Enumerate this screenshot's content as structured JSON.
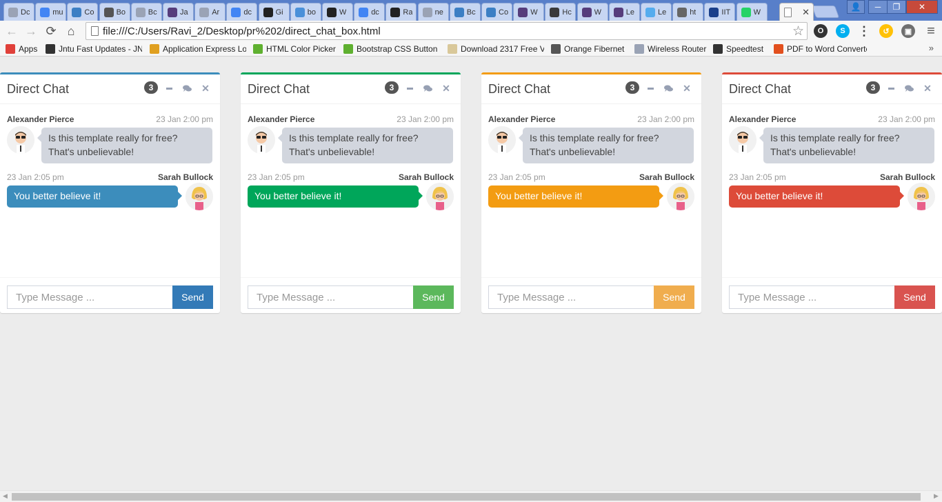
{
  "browser": {
    "tabs": [
      {
        "title": "Dc",
        "icon": "document-icon",
        "color": "#9aa3b5"
      },
      {
        "title": "mu",
        "icon": "google-icon",
        "color": "#4285f4"
      },
      {
        "title": "Co",
        "icon": "bootstrap-icon",
        "color": "#3c7fc4"
      },
      {
        "title": "Bo",
        "icon": "bootstrap-b-icon",
        "color": "#555555"
      },
      {
        "title": "Bc",
        "icon": "document-icon",
        "color": "#9aa3b5"
      },
      {
        "title": "Ja",
        "icon": "bootstrap-b-icon",
        "color": "#563d7c"
      },
      {
        "title": "Ar",
        "icon": "document-icon",
        "color": "#9aa3b5"
      },
      {
        "title": "dc",
        "icon": "google-icon",
        "color": "#4285f4"
      },
      {
        "title": "Gi",
        "icon": "github-icon",
        "color": "#222222"
      },
      {
        "title": "bo",
        "icon": "chrome-page-icon",
        "color": "#4a90d9"
      },
      {
        "title": "W",
        "icon": "github-icon",
        "color": "#222222"
      },
      {
        "title": "dc",
        "icon": "google-icon",
        "color": "#4285f4"
      },
      {
        "title": "Ra",
        "icon": "github-icon",
        "color": "#222222"
      },
      {
        "title": "ne",
        "icon": "document-icon",
        "color": "#9aa3b5"
      },
      {
        "title": "Bc",
        "icon": "bootstrap-icon",
        "color": "#3c7fc4"
      },
      {
        "title": "Co",
        "icon": "bootstrap-icon",
        "color": "#3c7fc4"
      },
      {
        "title": "W",
        "icon": "bootstrap-b-icon",
        "color": "#563d7c"
      },
      {
        "title": "Hc",
        "icon": "x-icon",
        "color": "#3a3a3a"
      },
      {
        "title": "W",
        "icon": "bootstrap-b-icon",
        "color": "#563d7c"
      },
      {
        "title": "Le",
        "icon": "bootstrap-b-icon",
        "color": "#563d7c"
      },
      {
        "title": "Le",
        "icon": "twitter-icon",
        "color": "#55acee"
      },
      {
        "title": "ht",
        "icon": "wifi-icon",
        "color": "#666666"
      },
      {
        "title": "IIT",
        "icon": "iitb-icon",
        "color": "#1a3f8a"
      },
      {
        "title": "W",
        "icon": "whatsapp-icon",
        "color": "#25d366"
      }
    ],
    "active_tab": {
      "close": "✕"
    },
    "window_controls": {
      "user": "👤",
      "minimize": "─",
      "maximize": "❐",
      "close": "✕"
    },
    "nav": {
      "back": "←",
      "forward": "→",
      "reload": "⟳",
      "home": "⌂"
    },
    "url": "file:///C:/Users/Ravi_2/Desktop/pr%202/direct_chat_box.html",
    "star": "☆",
    "extensions": [
      {
        "name": "opera-icon",
        "label": "O",
        "color": "#333333"
      },
      {
        "name": "skype-icon",
        "label": "S",
        "color": "#00aff0"
      },
      {
        "name": "apps-grid-icon",
        "label": "⋮",
        "color": "#444444"
      },
      {
        "name": "google-extension-icon",
        "label": "↺",
        "color": "#ffc107"
      },
      {
        "name": "ghostery-icon",
        "label": "▣",
        "color": "#6f6f6f"
      },
      {
        "name": "menu-icon",
        "label": "≡",
        "color": "#555555"
      }
    ],
    "bookmarks": [
      {
        "label": "Apps",
        "icon": "apps-icon",
        "color": "#e0403a"
      },
      {
        "label": "Jntu Fast Updates - JN",
        "icon": "graduation-cap-icon",
        "color": "#333333"
      },
      {
        "label": "Application Express Lo",
        "icon": "chart-icon",
        "color": "#e0a020"
      },
      {
        "label": "HTML Color Picker",
        "icon": "w3-icon",
        "color": "#5fb030"
      },
      {
        "label": "Bootstrap CSS Button",
        "icon": "w3-icon",
        "color": "#5fb030"
      },
      {
        "label": "Download 2317 Free V",
        "icon": "folder-icon",
        "color": "#d9c89a"
      },
      {
        "label": "Orange Fibernet",
        "icon": "wifi-icon",
        "color": "#555555"
      },
      {
        "label": "Wireless Router",
        "icon": "document-icon",
        "color": "#9aa3b5"
      },
      {
        "label": "Speedtest",
        "icon": "gauge-icon",
        "color": "#333333"
      },
      {
        "label": "PDF to Word Converte",
        "icon": "pdf-icon",
        "color": "#e2501e"
      }
    ],
    "bookmarks_more": "»"
  },
  "chat_common": {
    "title": "Direct Chat",
    "badge": "3",
    "msg1": {
      "name": "Alexander Pierce",
      "time": "23 Jan 2:00 pm",
      "text": "Is this template really for free? That's unbelievable!"
    },
    "msg2": {
      "name": "Sarah Bullock",
      "time": "23 Jan 2:05 pm",
      "text": "You better believe it!"
    },
    "placeholder": "Type Message ...",
    "send_label": "Send",
    "close_glyph": "✕"
  },
  "chats": [
    {
      "name": "primary",
      "accent": "#3c8dbc",
      "button": "#337ab7"
    },
    {
      "name": "success",
      "accent": "#00a65a",
      "button": "#5cb85c"
    },
    {
      "name": "warning",
      "accent": "#f39c12",
      "button": "#f0ad4e"
    },
    {
      "name": "danger",
      "accent": "#dd4b39",
      "button": "#d9534f"
    }
  ],
  "scrollbar": {
    "left": "◀",
    "right": "▶"
  }
}
